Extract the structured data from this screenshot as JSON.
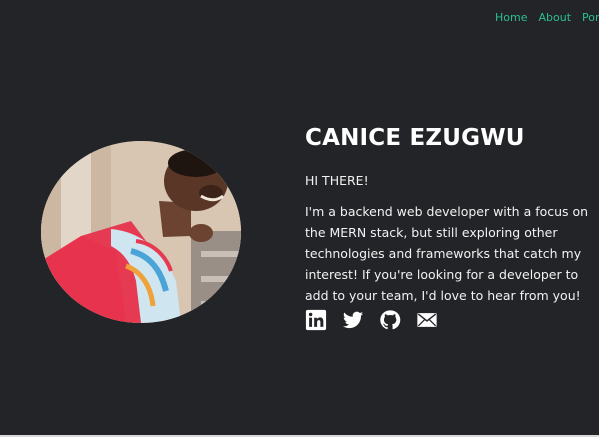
{
  "nav": {
    "items": [
      {
        "label": "Home"
      },
      {
        "label": "About"
      },
      {
        "label": "Portfo"
      }
    ]
  },
  "profile": {
    "name": "CANICE EZUGWU",
    "greeting": "HI THERE!",
    "bio": "I'm a backend web developer with a focus on the MERN stack, but still exploring other technologies and frameworks that catch my interest! If you're looking for a developer to add to your team, I'd love to hear from you!",
    "photo": "profile-photo"
  },
  "social": [
    {
      "icon": "linkedin-icon"
    },
    {
      "icon": "twitter-icon"
    },
    {
      "icon": "github-icon"
    },
    {
      "icon": "email-icon"
    }
  ],
  "colors": {
    "background": "#222428",
    "nav_link": "#2bbf8e",
    "text": "#ffffff"
  }
}
